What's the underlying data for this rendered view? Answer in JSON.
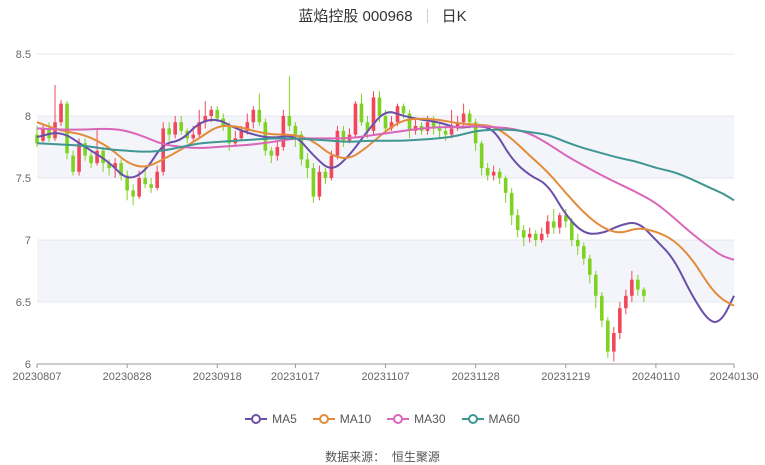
{
  "header": {
    "stock_name_code": "蓝焰控股 000968",
    "period": "日K"
  },
  "source": {
    "label": "数据来源：",
    "provider": "恒生聚源"
  },
  "colors": {
    "up": "#f0485a",
    "down": "#7ed321",
    "MA5": "#6a4fa8",
    "MA10": "#e38b3a",
    "MA30": "#d966b8",
    "MA60": "#3f9693"
  },
  "chart_data": {
    "type": "candlestick",
    "y_ticks": [
      "8.5",
      "8",
      "7.5",
      "7",
      "6.5",
      "6"
    ],
    "ylim": [
      6,
      8.5
    ],
    "grid": true,
    "legend_position": "bottom",
    "x_labels": [
      "20230807",
      "20230828",
      "20230918",
      "20231017",
      "20231107",
      "20231128",
      "20231219",
      "20240110",
      "20240130"
    ],
    "x_label_index": [
      0,
      15,
      30,
      43,
      58,
      73,
      88,
      103,
      116
    ],
    "series": [
      {
        "name": "MA5",
        "points": [
          [
            0,
            7.83
          ],
          [
            4,
            7.88
          ],
          [
            8,
            7.75
          ],
          [
            12,
            7.63
          ],
          [
            15,
            7.48
          ],
          [
            18,
            7.55
          ],
          [
            21,
            7.78
          ],
          [
            24,
            7.8
          ],
          [
            27,
            7.95
          ],
          [
            30,
            7.98
          ],
          [
            33,
            7.9
          ],
          [
            36,
            7.85
          ],
          [
            39,
            7.82
          ],
          [
            43,
            7.85
          ],
          [
            46,
            7.68
          ],
          [
            49,
            7.55
          ],
          [
            52,
            7.68
          ],
          [
            55,
            7.88
          ],
          [
            58,
            8.05
          ],
          [
            61,
            8.0
          ],
          [
            64,
            7.97
          ],
          [
            67,
            7.95
          ],
          [
            70,
            7.9
          ],
          [
            73,
            7.92
          ],
          [
            76,
            7.9
          ],
          [
            79,
            7.65
          ],
          [
            82,
            7.52
          ],
          [
            85,
            7.45
          ],
          [
            88,
            7.2
          ],
          [
            91,
            7.05
          ],
          [
            94,
            7.05
          ],
          [
            97,
            7.12
          ],
          [
            100,
            7.15
          ],
          [
            103,
            7.0
          ],
          [
            106,
            6.85
          ],
          [
            109,
            6.55
          ],
          [
            112,
            6.33
          ],
          [
            114,
            6.35
          ],
          [
            116,
            6.55
          ]
        ]
      },
      {
        "name": "MA10",
        "points": [
          [
            0,
            7.95
          ],
          [
            4,
            7.88
          ],
          [
            8,
            7.85
          ],
          [
            12,
            7.75
          ],
          [
            15,
            7.62
          ],
          [
            18,
            7.58
          ],
          [
            21,
            7.65
          ],
          [
            24,
            7.73
          ],
          [
            27,
            7.82
          ],
          [
            30,
            7.92
          ],
          [
            33,
            7.92
          ],
          [
            36,
            7.88
          ],
          [
            39,
            7.85
          ],
          [
            43,
            7.85
          ],
          [
            46,
            7.8
          ],
          [
            49,
            7.68
          ],
          [
            52,
            7.65
          ],
          [
            55,
            7.75
          ],
          [
            58,
            7.88
          ],
          [
            61,
            7.97
          ],
          [
            64,
            7.98
          ],
          [
            67,
            7.97
          ],
          [
            70,
            7.94
          ],
          [
            73,
            7.93
          ],
          [
            76,
            7.92
          ],
          [
            79,
            7.82
          ],
          [
            82,
            7.68
          ],
          [
            85,
            7.55
          ],
          [
            88,
            7.38
          ],
          [
            91,
            7.22
          ],
          [
            94,
            7.1
          ],
          [
            97,
            7.05
          ],
          [
            100,
            7.1
          ],
          [
            103,
            7.07
          ],
          [
            106,
            7.0
          ],
          [
            109,
            6.85
          ],
          [
            112,
            6.62
          ],
          [
            114,
            6.52
          ],
          [
            116,
            6.47
          ]
        ]
      },
      {
        "name": "MA30",
        "points": [
          [
            0,
            7.9
          ],
          [
            4,
            7.89
          ],
          [
            8,
            7.89
          ],
          [
            12,
            7.9
          ],
          [
            15,
            7.88
          ],
          [
            18,
            7.83
          ],
          [
            21,
            7.77
          ],
          [
            24,
            7.75
          ],
          [
            27,
            7.74
          ],
          [
            30,
            7.75
          ],
          [
            33,
            7.76
          ],
          [
            36,
            7.77
          ],
          [
            39,
            7.79
          ],
          [
            43,
            7.82
          ],
          [
            46,
            7.82
          ],
          [
            49,
            7.82
          ],
          [
            52,
            7.82
          ],
          [
            55,
            7.84
          ],
          [
            58,
            7.86
          ],
          [
            61,
            7.88
          ],
          [
            64,
            7.9
          ],
          [
            67,
            7.91
          ],
          [
            70,
            7.91
          ],
          [
            73,
            7.92
          ],
          [
            76,
            7.91
          ],
          [
            79,
            7.9
          ],
          [
            82,
            7.86
          ],
          [
            85,
            7.78
          ],
          [
            88,
            7.68
          ],
          [
            91,
            7.6
          ],
          [
            94,
            7.52
          ],
          [
            97,
            7.45
          ],
          [
            100,
            7.38
          ],
          [
            103,
            7.3
          ],
          [
            106,
            7.18
          ],
          [
            109,
            7.05
          ],
          [
            112,
            6.94
          ],
          [
            114,
            6.87
          ],
          [
            116,
            6.84
          ]
        ]
      },
      {
        "name": "MA60",
        "points": [
          [
            0,
            7.78
          ],
          [
            4,
            7.77
          ],
          [
            8,
            7.76
          ],
          [
            12,
            7.73
          ],
          [
            15,
            7.72
          ],
          [
            18,
            7.71
          ],
          [
            21,
            7.72
          ],
          [
            24,
            7.75
          ],
          [
            27,
            7.78
          ],
          [
            30,
            7.79
          ],
          [
            33,
            7.8
          ],
          [
            36,
            7.81
          ],
          [
            39,
            7.82
          ],
          [
            43,
            7.82
          ],
          [
            46,
            7.81
          ],
          [
            49,
            7.8
          ],
          [
            52,
            7.79
          ],
          [
            55,
            7.8
          ],
          [
            58,
            7.8
          ],
          [
            61,
            7.8
          ],
          [
            64,
            7.81
          ],
          [
            67,
            7.82
          ],
          [
            70,
            7.84
          ],
          [
            73,
            7.88
          ],
          [
            76,
            7.89
          ],
          [
            79,
            7.89
          ],
          [
            82,
            7.87
          ],
          [
            85,
            7.85
          ],
          [
            88,
            7.79
          ],
          [
            91,
            7.74
          ],
          [
            94,
            7.7
          ],
          [
            97,
            7.66
          ],
          [
            100,
            7.63
          ],
          [
            103,
            7.58
          ],
          [
            106,
            7.55
          ],
          [
            109,
            7.49
          ],
          [
            112,
            7.42
          ],
          [
            114,
            7.38
          ],
          [
            116,
            7.32
          ]
        ]
      }
    ],
    "candles": [
      [
        7.85,
        7.78,
        7.92,
        7.75
      ],
      [
        7.8,
        7.9,
        7.94,
        7.77
      ],
      [
        7.9,
        7.82,
        7.95,
        7.79
      ],
      [
        7.82,
        7.95,
        8.25,
        7.8
      ],
      [
        7.95,
        8.1,
        8.13,
        7.92
      ],
      [
        8.1,
        7.7,
        8.12,
        7.65
      ],
      [
        7.68,
        7.55,
        7.72,
        7.52
      ],
      [
        7.55,
        7.78,
        7.82,
        7.52
      ],
      [
        7.78,
        7.68,
        7.82,
        7.64
      ],
      [
        7.68,
        7.62,
        7.72,
        7.58
      ],
      [
        7.62,
        7.72,
        7.9,
        7.6
      ],
      [
        7.72,
        7.62,
        7.75,
        7.55
      ],
      [
        7.62,
        7.58,
        7.65,
        7.52
      ],
      [
        7.58,
        7.62,
        7.66,
        7.5
      ],
      [
        7.62,
        7.52,
        7.65,
        7.48
      ],
      [
        7.52,
        7.4,
        7.56,
        7.32
      ],
      [
        7.4,
        7.35,
        7.45,
        7.28
      ],
      [
        7.35,
        7.5,
        7.56,
        7.33
      ],
      [
        7.5,
        7.45,
        7.6,
        7.42
      ],
      [
        7.45,
        7.42,
        7.5,
        7.38
      ],
      [
        7.42,
        7.55,
        7.6,
        7.4
      ],
      [
        7.55,
        7.9,
        7.95,
        7.52
      ],
      [
        7.9,
        7.85,
        7.95,
        7.8
      ],
      [
        7.85,
        7.95,
        8.0,
        7.82
      ],
      [
        7.95,
        7.88,
        8.0,
        7.85
      ],
      [
        7.88,
        7.82,
        7.9,
        7.78
      ],
      [
        7.82,
        7.85,
        7.92,
        7.8
      ],
      [
        7.85,
        7.95,
        8.05,
        7.83
      ],
      [
        7.95,
        8.0,
        8.12,
        7.9
      ],
      [
        8.0,
        8.05,
        8.08,
        7.95
      ],
      [
        8.05,
        7.98,
        8.08,
        7.95
      ],
      [
        7.98,
        7.92,
        8.02,
        7.88
      ],
      [
        7.92,
        7.78,
        7.95,
        7.72
      ],
      [
        7.78,
        7.82,
        7.88,
        7.75
      ],
      [
        7.82,
        7.88,
        7.92,
        7.8
      ],
      [
        7.88,
        7.95,
        8.02,
        7.85
      ],
      [
        7.95,
        8.05,
        8.08,
        7.9
      ],
      [
        8.05,
        7.95,
        8.18,
        7.92
      ],
      [
        7.95,
        7.72,
        7.98,
        7.68
      ],
      [
        7.72,
        7.68,
        7.75,
        7.62
      ],
      [
        7.68,
        7.75,
        7.8,
        7.64
      ],
      [
        7.75,
        8.0,
        8.05,
        7.72
      ],
      [
        8.0,
        7.92,
        8.32,
        7.88
      ],
      [
        7.92,
        7.85,
        7.95,
        7.75
      ],
      [
        7.85,
        7.65,
        7.88,
        7.6
      ],
      [
        7.65,
        7.58,
        7.7,
        7.5
      ],
      [
        7.58,
        7.35,
        7.62,
        7.3
      ],
      [
        7.35,
        7.55,
        7.6,
        7.32
      ],
      [
        7.55,
        7.5,
        7.58,
        7.45
      ],
      [
        7.5,
        7.68,
        7.72,
        7.48
      ],
      [
        7.68,
        7.88,
        7.92,
        7.65
      ],
      [
        7.88,
        7.8,
        7.92,
        7.75
      ],
      [
        7.8,
        7.85,
        7.9,
        7.78
      ],
      [
        7.85,
        8.1,
        8.12,
        7.82
      ],
      [
        8.1,
        7.95,
        8.18,
        7.92
      ],
      [
        7.95,
        7.88,
        8.0,
        7.82
      ],
      [
        7.88,
        8.15,
        8.2,
        7.85
      ],
      [
        8.15,
        8.0,
        8.2,
        7.95
      ],
      [
        8.0,
        7.9,
        8.05,
        7.85
      ],
      [
        7.9,
        7.95,
        8.0,
        7.88
      ],
      [
        7.95,
        8.08,
        8.1,
        7.92
      ],
      [
        8.08,
        8.02,
        8.1,
        7.98
      ],
      [
        8.02,
        7.88,
        8.05,
        7.82
      ],
      [
        7.88,
        7.92,
        7.98,
        7.85
      ],
      [
        7.92,
        7.88,
        7.95,
        7.85
      ],
      [
        7.88,
        7.95,
        8.0,
        7.85
      ],
      [
        7.95,
        7.9,
        8.0,
        7.85
      ],
      [
        7.9,
        7.88,
        7.95,
        7.82
      ],
      [
        7.88,
        7.85,
        7.92,
        7.8
      ],
      [
        7.85,
        7.9,
        8.05,
        7.82
      ],
      [
        7.9,
        7.95,
        8.0,
        7.88
      ],
      [
        7.95,
        8.02,
        8.1,
        7.92
      ],
      [
        8.02,
        7.95,
        8.05,
        7.9
      ],
      [
        7.95,
        7.78,
        7.98,
        7.72
      ],
      [
        7.78,
        7.58,
        7.8,
        7.52
      ],
      [
        7.58,
        7.52,
        7.62,
        7.48
      ],
      [
        7.52,
        7.55,
        7.6,
        7.48
      ],
      [
        7.55,
        7.5,
        7.58,
        7.45
      ],
      [
        7.5,
        7.38,
        7.52,
        7.3
      ],
      [
        7.38,
        7.2,
        7.42,
        7.12
      ],
      [
        7.2,
        7.08,
        7.25,
        7.02
      ],
      [
        7.08,
        7.02,
        7.12,
        6.95
      ],
      [
        7.02,
        7.05,
        7.1,
        6.98
      ],
      [
        7.05,
        7.0,
        7.08,
        6.95
      ],
      [
        7.0,
        7.05,
        7.1,
        6.98
      ],
      [
        7.05,
        7.15,
        7.2,
        7.02
      ],
      [
        7.15,
        7.1,
        7.25,
        7.05
      ],
      [
        7.1,
        7.2,
        7.22,
        7.05
      ],
      [
        7.2,
        7.15,
        7.25,
        7.1
      ],
      [
        7.15,
        7.0,
        7.18,
        6.95
      ],
      [
        7.0,
        6.95,
        7.05,
        6.88
      ],
      [
        6.95,
        6.85,
        6.98,
        6.8
      ],
      [
        6.85,
        6.72,
        6.88,
        6.65
      ],
      [
        6.72,
        6.55,
        6.75,
        6.45
      ],
      [
        6.55,
        6.35,
        6.58,
        6.3
      ],
      [
        6.35,
        6.1,
        6.38,
        6.05
      ],
      [
        6.1,
        6.25,
        6.3,
        6.02
      ],
      [
        6.25,
        6.45,
        6.5,
        6.2
      ],
      [
        6.45,
        6.55,
        6.6,
        6.4
      ],
      [
        6.55,
        6.68,
        6.75,
        6.5
      ],
      [
        6.68,
        6.6,
        6.72,
        6.55
      ],
      [
        6.6,
        6.55,
        6.62,
        6.5
      ]
    ]
  }
}
